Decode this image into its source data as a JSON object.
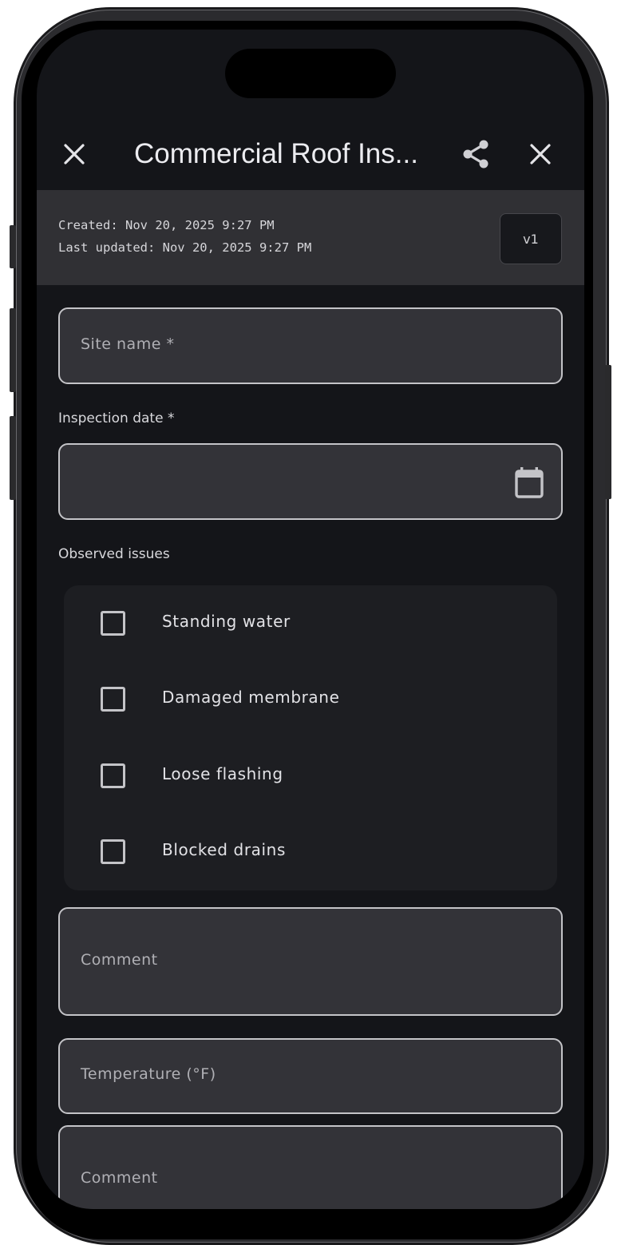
{
  "header": {
    "title": "Commercial Roof Ins..."
  },
  "meta": {
    "created": "Created: Nov 20, 2025 9:27 PM",
    "updated": "Last updated: Nov 20, 2025 9:27 PM",
    "version": "v1"
  },
  "form": {
    "site_name_placeholder": "Site name *",
    "inspection_date_label": "Inspection date *",
    "inspection_date_value": "",
    "observed_issues_label": "Observed issues",
    "issues": [
      {
        "label": "Standing water",
        "checked": false
      },
      {
        "label": "Damaged membrane",
        "checked": false
      },
      {
        "label": "Loose flashing",
        "checked": false
      },
      {
        "label": "Blocked drains",
        "checked": false
      }
    ],
    "comment_placeholder": "Comment",
    "temperature_placeholder": "Temperature (°F)",
    "comment2_placeholder": "Comment"
  },
  "icons": {
    "close": "close-icon",
    "share": "share-icon",
    "calendar": "calendar-icon"
  },
  "colors": {
    "background": "#141519",
    "meta_band": "#303034",
    "field_bg": "#333338",
    "field_border": "#c4c4c8",
    "checklist_bg": "#1d1e22"
  }
}
